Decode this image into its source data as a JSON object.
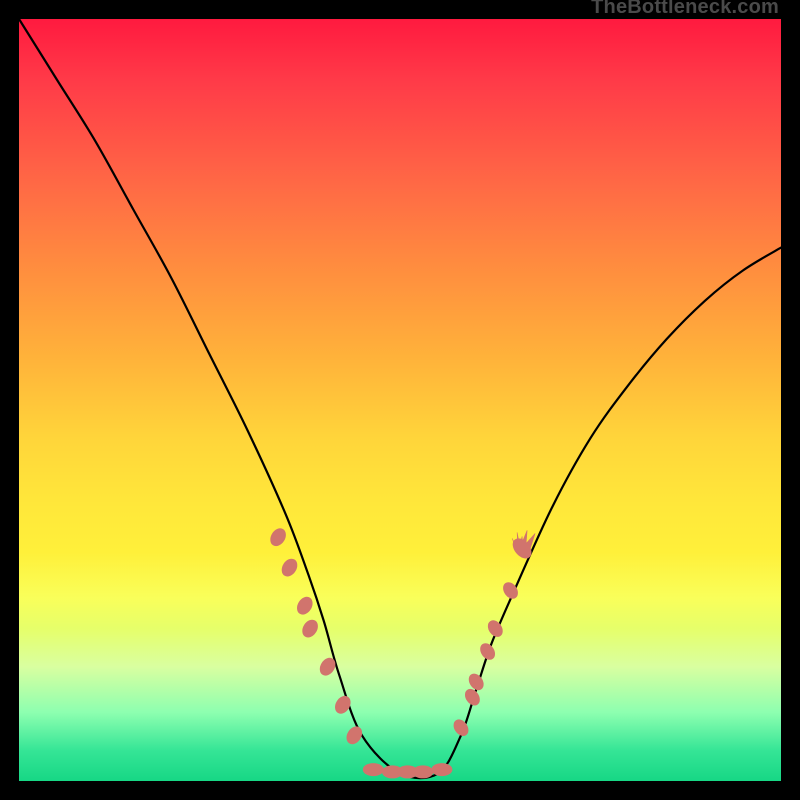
{
  "watermark": "TheBottleneck.com",
  "chart_data": {
    "type": "line",
    "title": "",
    "xlabel": "",
    "ylabel": "",
    "xlim": [
      0,
      100
    ],
    "ylim": [
      0,
      100
    ],
    "grid": false,
    "legend": false,
    "series": [
      {
        "name": "curve",
        "x": [
          0,
          5,
          10,
          15,
          20,
          25,
          30,
          35,
          38,
          40,
          42,
          45,
          50,
          55,
          58,
          60,
          62,
          65,
          70,
          75,
          80,
          85,
          90,
          95,
          100
        ],
        "y": [
          100,
          92,
          84,
          75,
          66,
          56,
          46,
          35,
          27,
          21,
          14,
          6,
          1,
          1,
          6,
          12,
          18,
          25,
          36,
          45,
          52,
          58,
          63,
          67,
          70
        ]
      }
    ],
    "markers": {
      "left_beads": [
        [
          34,
          32
        ],
        [
          35.5,
          28
        ],
        [
          37.5,
          23
        ],
        [
          38.2,
          20
        ],
        [
          40.5,
          15
        ],
        [
          42.5,
          10
        ],
        [
          44,
          6
        ]
      ],
      "flat_beads": [
        [
          46.5,
          1.5
        ],
        [
          49,
          1.2
        ],
        [
          51,
          1.2
        ],
        [
          53,
          1.2
        ],
        [
          55.5,
          1.5
        ]
      ],
      "right_beads": [
        [
          58,
          7
        ],
        [
          59.5,
          11
        ],
        [
          60,
          13
        ],
        [
          61.5,
          17
        ],
        [
          62.5,
          20
        ],
        [
          64.5,
          25
        ]
      ],
      "right_flame": {
        "x": 65.5,
        "y": 30
      }
    }
  }
}
